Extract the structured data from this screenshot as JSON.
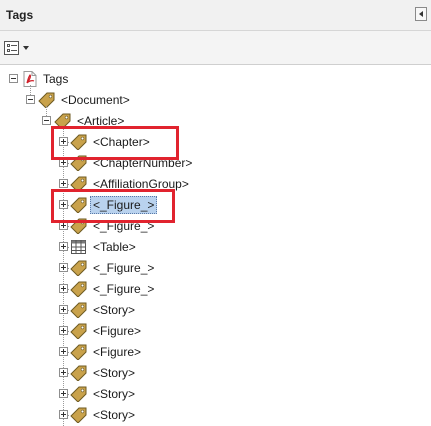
{
  "panel": {
    "title": "Tags"
  },
  "tree": {
    "root": {
      "label": "Tags",
      "icon": "pdf-icon"
    },
    "document": {
      "label": "<Document>",
      "icon": "tag-icon"
    },
    "article": {
      "label": "<Article>",
      "icon": "tag-icon"
    },
    "children": [
      {
        "label": "<Chapter>",
        "icon": "tag-icon",
        "highlighted": true
      },
      {
        "label": "<ChapterNumber>",
        "icon": "tag-icon"
      },
      {
        "label": "<AffiliationGroup>",
        "icon": "tag-icon"
      },
      {
        "label": "<_Figure_>",
        "icon": "tag-icon",
        "selected": true,
        "highlighted": true
      },
      {
        "label": "<_Figure_>",
        "icon": "tag-icon"
      },
      {
        "label": "<Table>",
        "icon": "table-icon"
      },
      {
        "label": "<_Figure_>",
        "icon": "tag-icon"
      },
      {
        "label": "<_Figure_>",
        "icon": "tag-icon"
      },
      {
        "label": "<Story>",
        "icon": "tag-icon"
      },
      {
        "label": "<Figure>",
        "icon": "tag-icon"
      },
      {
        "label": "<Figure>",
        "icon": "tag-icon"
      },
      {
        "label": "<Story>",
        "icon": "tag-icon"
      },
      {
        "label": "<Story>",
        "icon": "tag-icon"
      },
      {
        "label": "<Story>",
        "icon": "tag-icon"
      }
    ]
  },
  "colors": {
    "highlight_border": "#e1232e",
    "selection": "#b9d2ee",
    "tag_fill": "#c9a24b",
    "pdf_red": "#d0202a"
  }
}
